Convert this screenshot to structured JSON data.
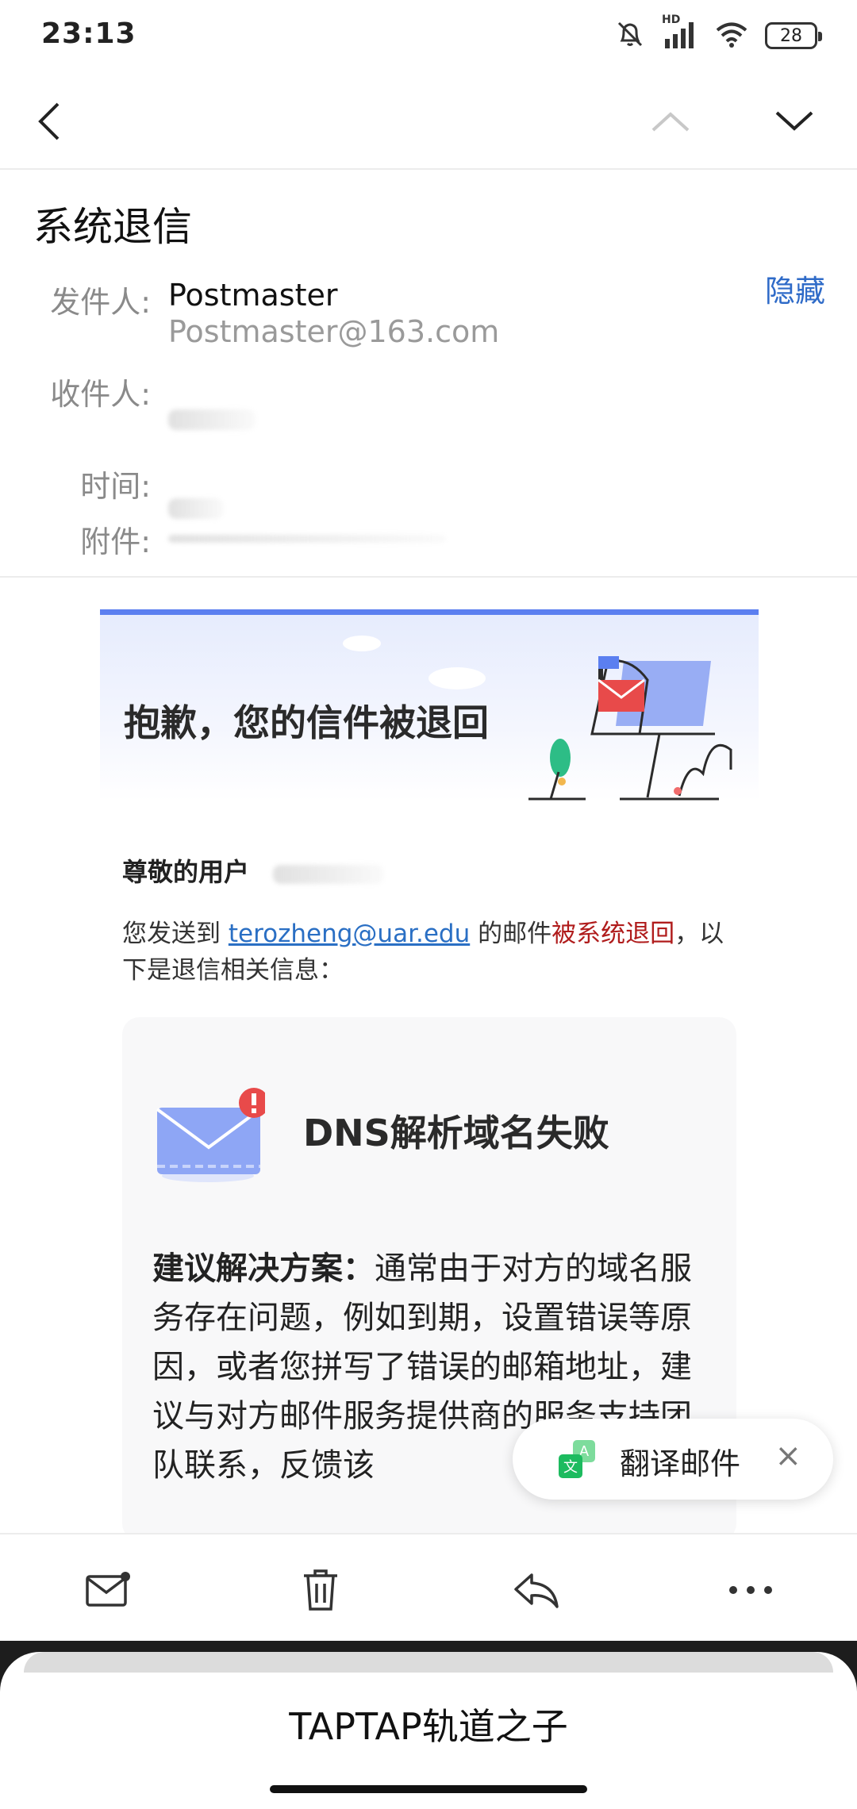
{
  "status_bar": {
    "time": "23:13",
    "battery": "28",
    "network": "HD",
    "icons": [
      "mute-icon",
      "signal-icon",
      "wifi-icon",
      "battery-icon"
    ]
  },
  "nav": {
    "back_icon": "chevron-left-icon",
    "prev_icon": "chevron-up-icon",
    "next_icon": "chevron-down-icon"
  },
  "email": {
    "subject": "系统退信",
    "hide_label": "隐藏",
    "from_label": "发件人:",
    "from_name": "Postmaster",
    "from_address": "Postmaster@163.com",
    "to_label": "收件人:",
    "time_label": "时间:",
    "attachment_label": "附件:"
  },
  "body": {
    "banner_title": "抱歉，您的信件被退回",
    "greeting": "尊敬的用户",
    "para_prefix": "您发送到 ",
    "recipient_link": "terozheng@uar.edu",
    "para_mid": " 的邮件",
    "para_red": "被系统退回",
    "para_suffix": "，以下是退信相关信息：",
    "card_title": "DNS解析域名失败",
    "suggestion_label": "建议解决方案：",
    "suggestion_text": "通常由于对方的域名服务存在问题，例如到期，设置错误等原因，或者您拼写了错误的邮箱地址，建议与对方邮件服务提供商的服务支持团队联系，反馈该"
  },
  "translate_pill": {
    "label": "翻译邮件",
    "close": "×"
  },
  "toolbar": {
    "icons": [
      "mail-unread-icon",
      "trash-icon",
      "reply-icon",
      "more-icon"
    ]
  },
  "sheet": {
    "title": "TAPTAP轨道之子"
  },
  "colors": {
    "accent": "#2f6bc8",
    "banner_border": "#5b7ff0",
    "bounce_red": "#b01c1c",
    "link": "#2a6fc4"
  }
}
